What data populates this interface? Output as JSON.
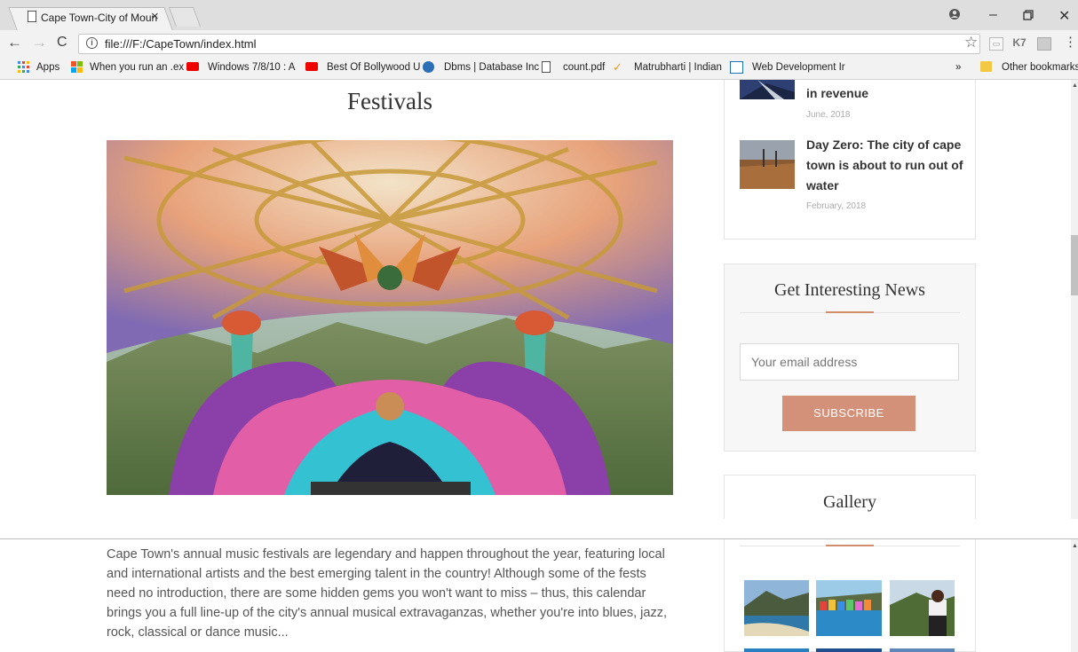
{
  "browser": {
    "tab_title": "Cape Town-City of Moun",
    "tab_close": "×",
    "url": "file:///F:/CapeTown/index.html",
    "bookmarks": [
      {
        "label": "Apps"
      },
      {
        "label": "When you run an .ex"
      },
      {
        "label": "Windows 7/8/10 : A"
      },
      {
        "label": "Best Of Bollywood U"
      },
      {
        "label": "Dbms | Database Inc"
      },
      {
        "label": "count.pdf"
      },
      {
        "label": "Matrubharti | Indian"
      },
      {
        "label": "Web Development Ir"
      }
    ],
    "more": "»",
    "other_bookmarks": "Other bookmarks"
  },
  "main": {
    "heading": "Festivals",
    "paragraph": "Cape Town's annual music festivals are legendary and happen throughout the year, featuring local and international artists and the best emerging talent in the country! Although some of the fests need no introduction, there are some hidden gems you won't want to miss – thus, this calendar brings you a full line-up of the city's annual musical extravaganzas, whether you're into blues, jazz, rock, classical or dance music..."
  },
  "sidebar": {
    "posts": [
      {
        "title": "in revenue",
        "date": "June, 2018"
      },
      {
        "title_lines": [
          "Day Zero: The city of cape",
          "town is about to run out of",
          "water"
        ],
        "date": "February, 2018"
      }
    ],
    "newsletter": {
      "title": "Get Interesting News",
      "placeholder": "Your email address",
      "button": "SUBSCRIBE"
    },
    "gallery": {
      "title": "Gallery"
    }
  },
  "colors": {
    "accent": "#d28d6f",
    "subscribe": "#d4917a"
  }
}
